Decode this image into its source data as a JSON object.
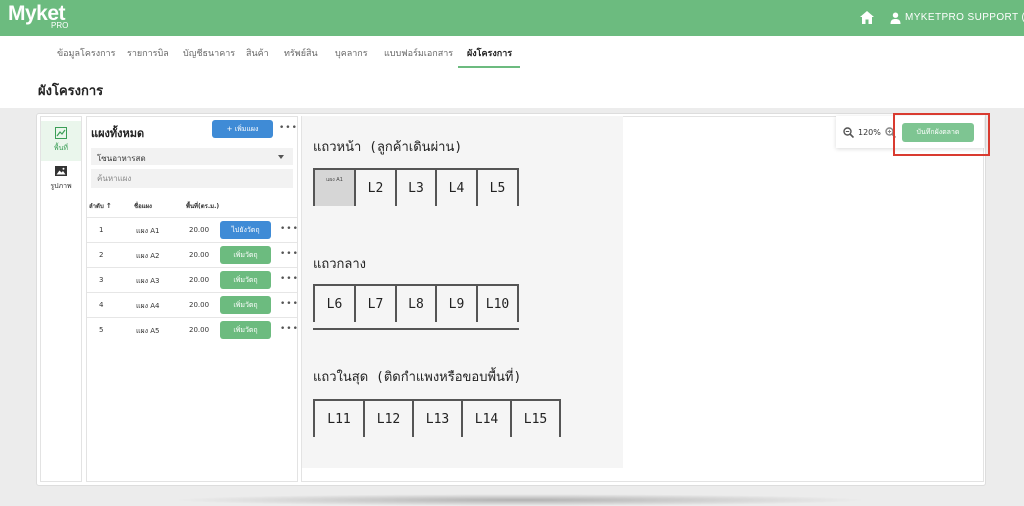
{
  "app": {
    "logo_text": "Myket",
    "logo_sub": "PRO",
    "user_name": "MYKETPRO SUPPORT (P)"
  },
  "nav": {
    "tabs": [
      {
        "label": "ข้อมูลโครงการ"
      },
      {
        "label": "รายการบิล"
      },
      {
        "label": "บัญชีธนาคาร"
      },
      {
        "label": "สินค้า"
      },
      {
        "label": "ทรัพย์สิน"
      },
      {
        "label": "บุคลากร"
      },
      {
        "label": "แบบฟอร์มเอกสาร"
      },
      {
        "label": "ผังโครงการ",
        "active": true
      }
    ]
  },
  "page": {
    "title": "ผังโครงการ"
  },
  "rail": {
    "items": [
      {
        "label": "พื้นที่",
        "icon": "chart-icon",
        "active": true
      },
      {
        "label": "รูปภาพ",
        "icon": "image-icon"
      }
    ]
  },
  "panel": {
    "title": "แผงทั้งหมด",
    "add_label": "+ เพิ่มแผง",
    "more": "•••",
    "zone_value": "โซนอาหารสด",
    "search_placeholder": "ค้นหาแผง",
    "columns": {
      "no": "ลำดับ",
      "name": "ชื่อแผง",
      "area": "พื้นที่(ตร.ม.)"
    },
    "rows": [
      {
        "no": "1",
        "name": "แผง A1",
        "area": "20.00",
        "action": "ไปยังวัตถุ",
        "action_color": "#3f8bd6"
      },
      {
        "no": "2",
        "name": "แผง A2",
        "area": "20.00",
        "action": "เพิ่มวัตถุ",
        "action_color": "#6cbb7f"
      },
      {
        "no": "3",
        "name": "แผง A3",
        "area": "20.00",
        "action": "เพิ่มวัตถุ",
        "action_color": "#6cbb7f"
      },
      {
        "no": "4",
        "name": "แผง A4",
        "area": "20.00",
        "action": "เพิ่มวัตถุ",
        "action_color": "#6cbb7f"
      },
      {
        "no": "5",
        "name": "แผง A5",
        "area": "20.00",
        "action": "เพิ่มวัตถุ",
        "action_color": "#6cbb7f"
      }
    ]
  },
  "canvas": {
    "rows": [
      {
        "label": "แถวหน้า (ลูกค้าเดินผ่าน)",
        "stalls": [
          "แผง A1",
          "L2",
          "L3",
          "L4",
          "L5"
        ]
      },
      {
        "label": "แถวกลาง",
        "stalls": [
          "L6",
          "L7",
          "L8",
          "L9",
          "L10"
        ]
      },
      {
        "label": "แถวในสุด (ติดกำแพงหรือขอบพื้นที่)",
        "stalls": [
          "L11",
          "L12",
          "L13",
          "L14",
          "L15"
        ]
      }
    ]
  },
  "toolbar": {
    "zoom_level": "120%",
    "save_label": "บันทึกผังตลาด"
  },
  "colors": {
    "brand": "#6cbb7f",
    "primary": "#3f8bd6",
    "highlight": "#d93b30"
  }
}
